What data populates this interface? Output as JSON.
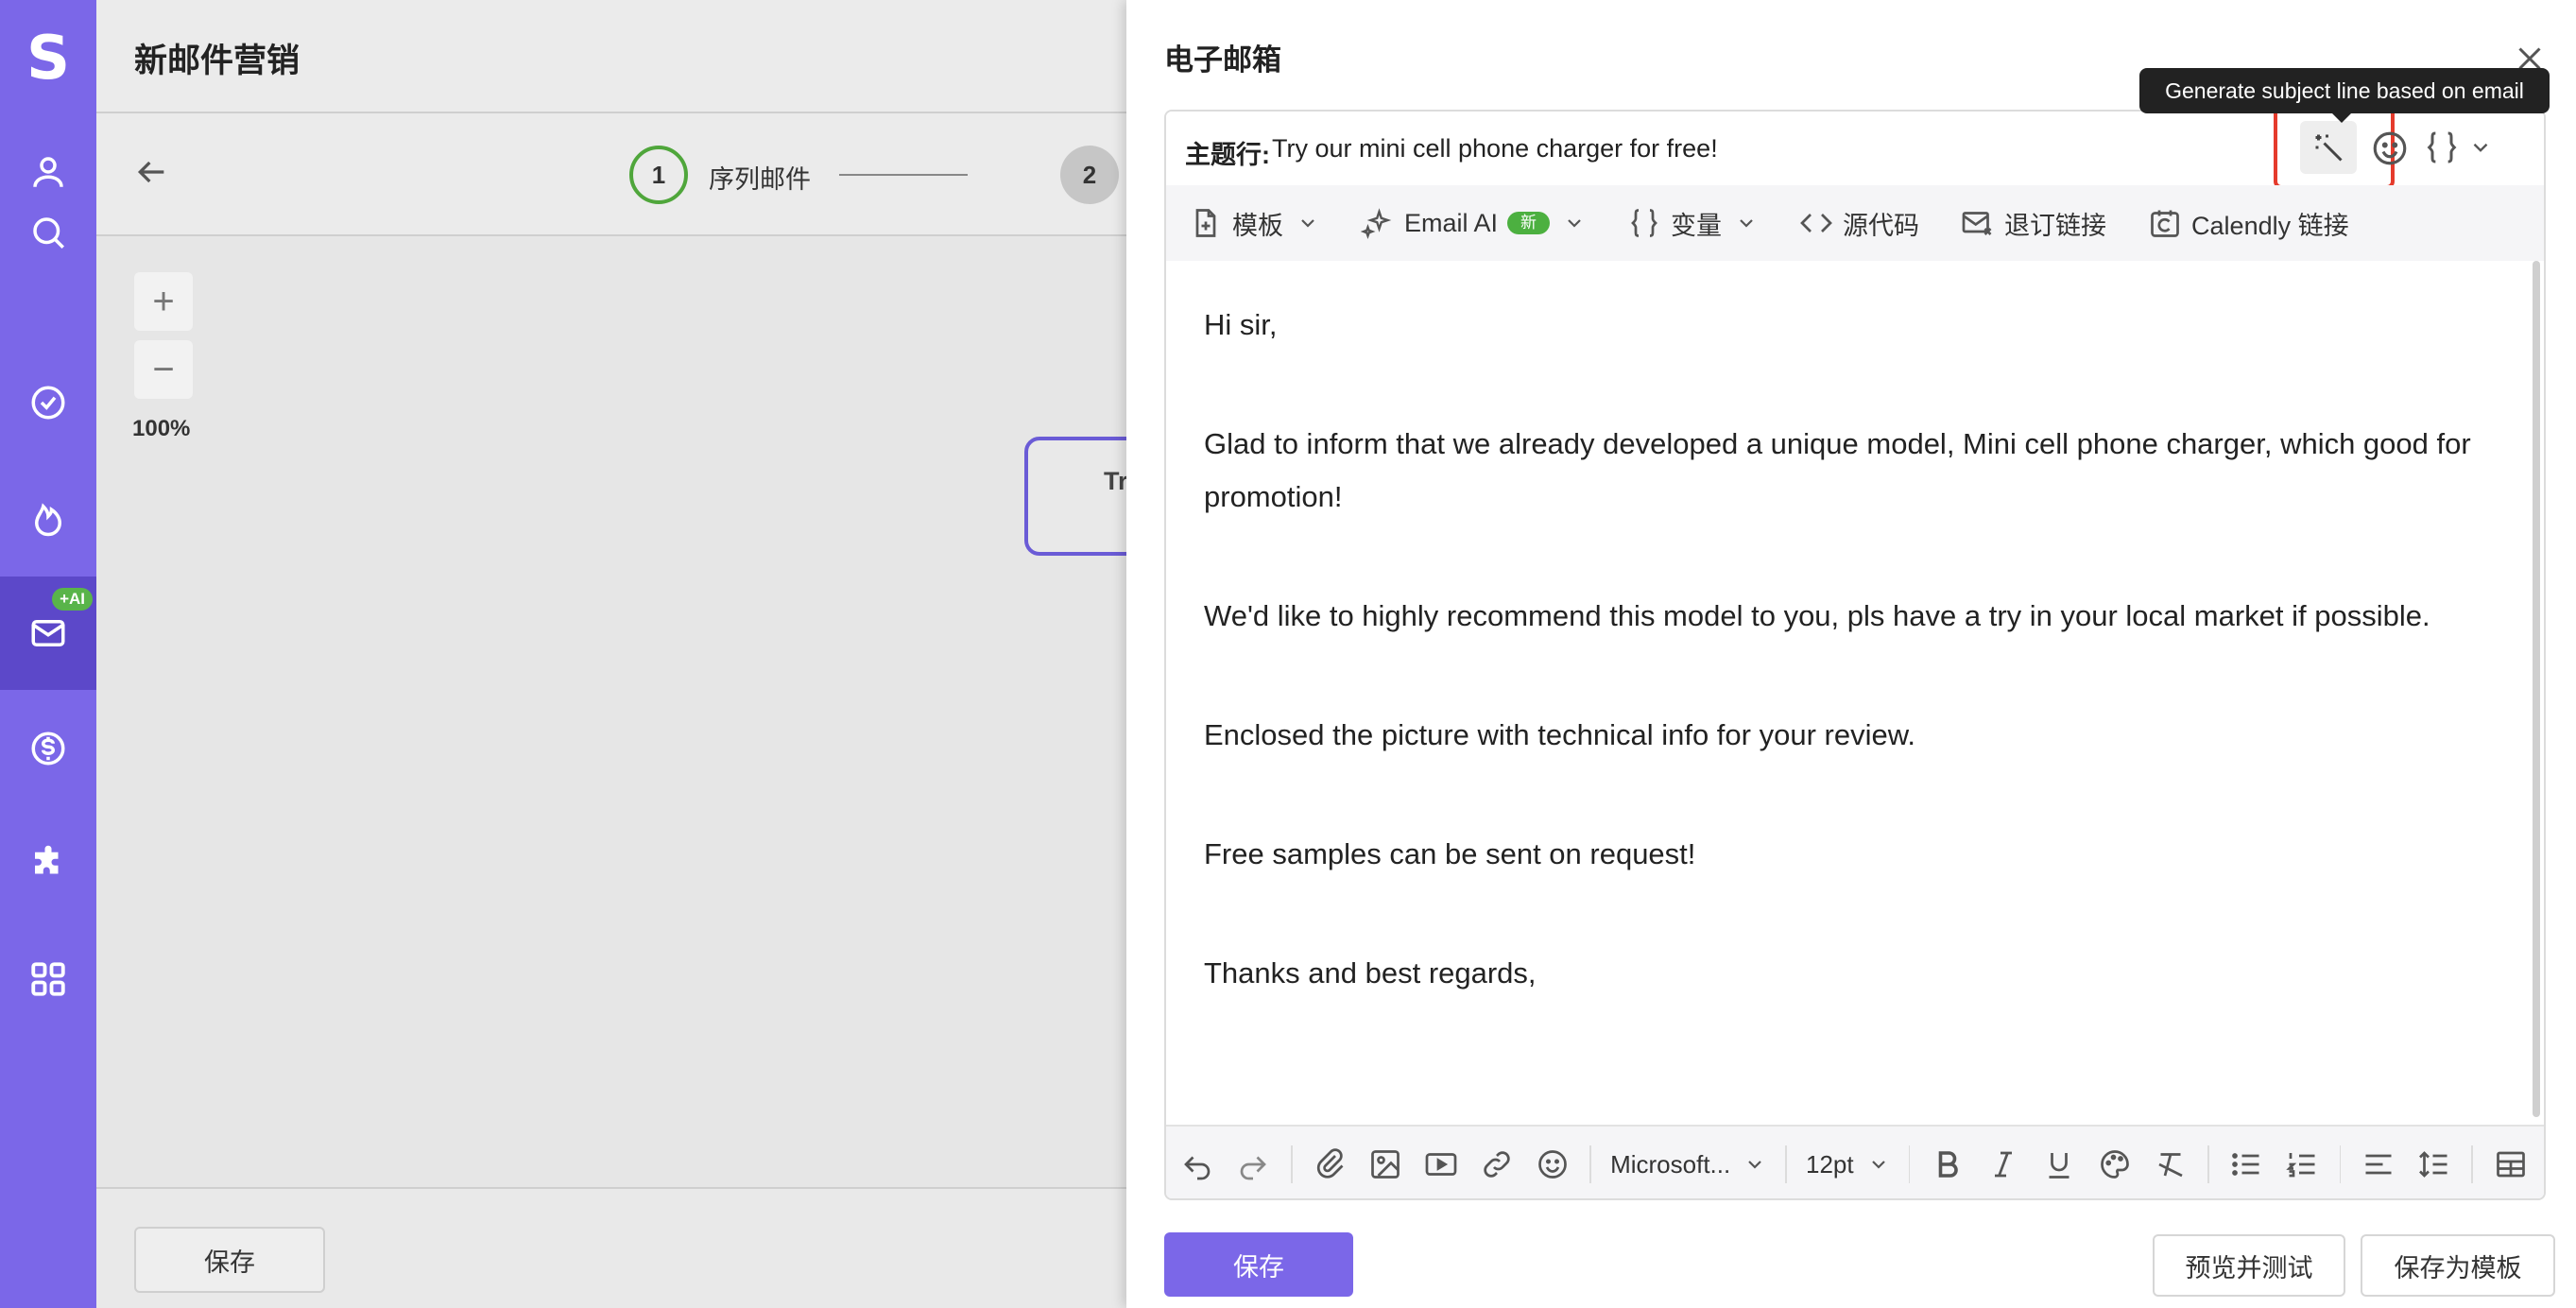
{
  "nav": {
    "logo": "S",
    "ai_badge": "+AI",
    "items": [
      "person-icon",
      "search-icon",
      "check-circle-icon",
      "fire-icon",
      "mail-icon",
      "dollar-icon",
      "puzzle-icon",
      "apps-icon"
    ]
  },
  "background_page": {
    "title": "新邮件营销",
    "steps": [
      {
        "number": "1",
        "label": "序列邮件"
      },
      {
        "number": "2",
        "label": ""
      }
    ],
    "zoom_in": "+",
    "zoom_out": "−",
    "zoom_level": "100%",
    "node_text": "Tr",
    "save_label": "保存"
  },
  "drawer": {
    "title": "电子邮箱",
    "tooltip": "Generate subject line based on email",
    "subject_label": "主题行:",
    "subject_value": "Try our mini cell phone charger for free!",
    "toolbar": {
      "template": "模板",
      "email_ai": "Email AI",
      "new_badge": "新",
      "variables": "变量",
      "source": "源代码",
      "unsubscribe": "退订链接",
      "calendly": "Calendly 链接"
    },
    "body": [
      "Hi sir,",
      "Glad to inform that we already developed a unique model, Mini cell phone charger, which good for promotion!",
      "We'd like to highly recommend this model to you, pls have a try in your local market if possible.",
      "Enclosed the picture with technical info for your review.",
      "Free samples can be sent on request!",
      "Thanks and best regards,"
    ],
    "font_family": "Microsoft...",
    "font_size": "12pt",
    "save_label": "保存",
    "preview_label": "预览并测试",
    "save_template_label": "保存为模板"
  }
}
